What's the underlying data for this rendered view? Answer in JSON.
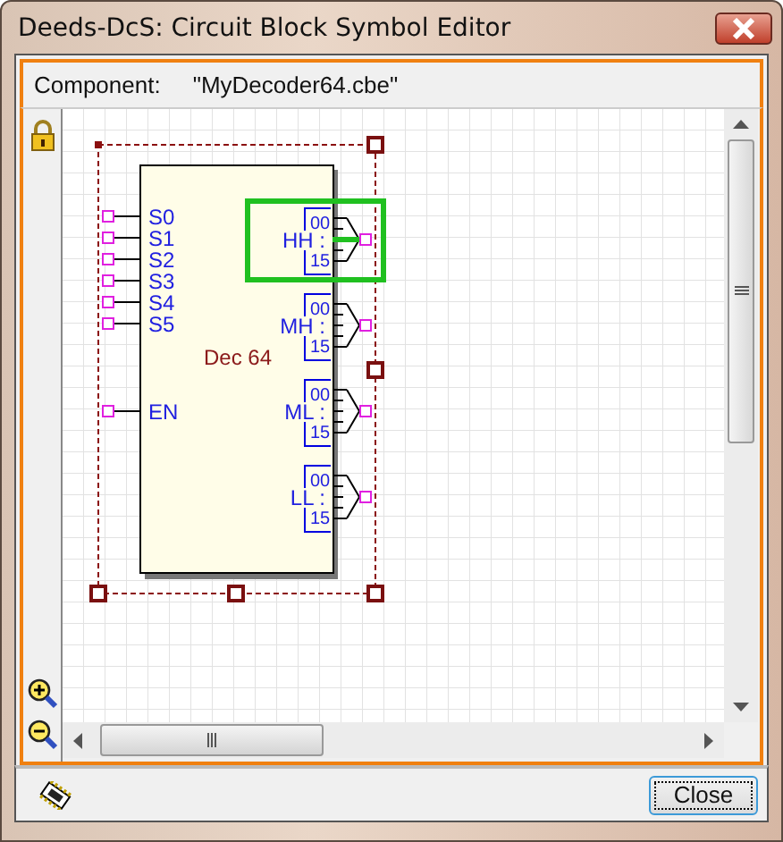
{
  "window": {
    "title": "Deeds-DcS: Circuit Block Symbol Editor"
  },
  "component": {
    "label": "Component:",
    "value": "\"MyDecoder64.cbe\""
  },
  "block": {
    "name": "Dec 64",
    "inputs": [
      {
        "label": "S0"
      },
      {
        "label": "S1"
      },
      {
        "label": "S2"
      },
      {
        "label": "S3"
      },
      {
        "label": "S4"
      },
      {
        "label": "S5"
      },
      {
        "label": "EN"
      }
    ],
    "outputs": [
      {
        "label": "HH :",
        "first": "00",
        "last": "15",
        "selected": true
      },
      {
        "label": "MH :",
        "first": "00",
        "last": "15",
        "selected": false
      },
      {
        "label": "ML :",
        "first": "00",
        "last": "15",
        "selected": false
      },
      {
        "label": "LL :",
        "first": "00",
        "last": "15",
        "selected": false
      }
    ]
  },
  "buttons": [
    {
      "label": "Close"
    }
  ]
}
